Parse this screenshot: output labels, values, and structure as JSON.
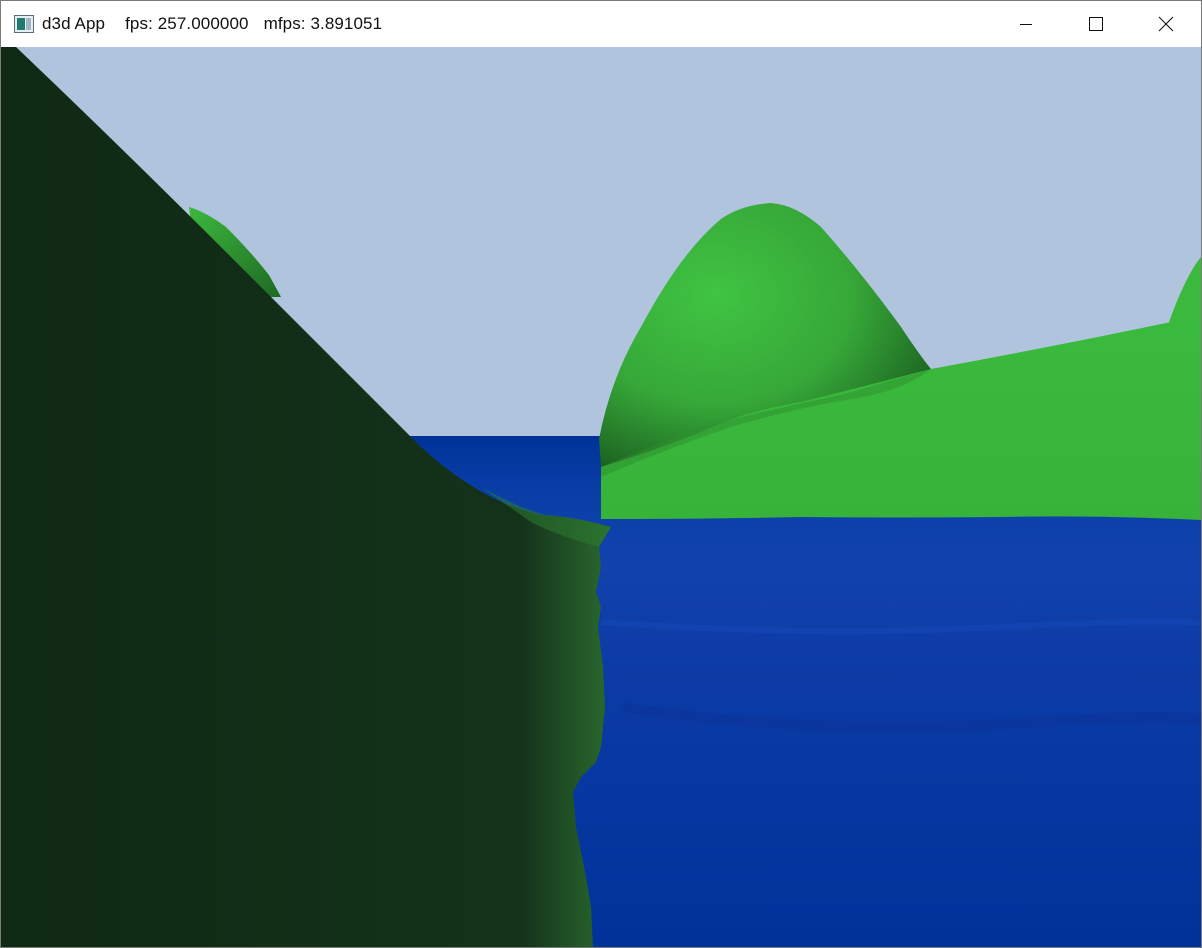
{
  "window": {
    "app_name": "d3d App",
    "fps_text": "fps: 257.000000",
    "mfps_text": "mfps: 3.891051",
    "icon": "application-window-icon"
  },
  "controls": {
    "minimize_icon": "minimize-icon",
    "maximize_icon": "maximize-icon",
    "close_icon": "close-icon"
  },
  "scene": {
    "sky_color": "#b0c4de",
    "water_color": "#003399",
    "water_highlight": "#1446b8",
    "hill_light": "#3fbf40",
    "hill_shadow": "#1a5a1e",
    "cliff_color": "#0f2914"
  }
}
